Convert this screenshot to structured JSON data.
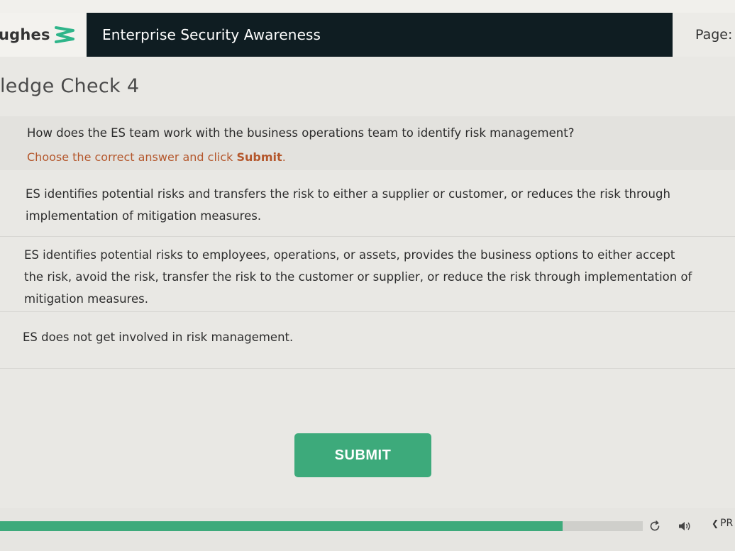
{
  "header": {
    "logo_text": "ughes",
    "course_title": "Enterprise Security Awareness",
    "page_label": "Page:"
  },
  "content": {
    "title": "ledge Check 4",
    "question": "How does the ES team work with the business operations team to identify risk management?",
    "instruction_prefix": "Choose the correct answer and click ",
    "instruction_bold": "Submit",
    "instruction_suffix": ".",
    "options": [
      {
        "text": "ES identifies potential risks and transfers the risk to either a supplier or customer, or reduces the risk through implementation of mitigation measures."
      },
      {
        "line1": "ES identifies potential risks to employees, operations, or assets, provides the business options to either accept",
        "line2": "the risk, avoid the risk, transfer the risk to the customer or supplier, or reduce the risk through implementation of",
        "line3": "mitigation measures."
      },
      {
        "text": "ES does not get involved in risk management."
      }
    ],
    "submit_label": "SUBMIT"
  },
  "footer": {
    "progress": 0.875,
    "prev_label": "PR"
  },
  "colors": {
    "accent_green": "#3daa7b",
    "title_bar": "#0f1d22",
    "instruction_orange": "#b4572c"
  },
  "icons": [
    "logo-mark-icon",
    "replay-icon",
    "volume-icon",
    "chevron-left-icon"
  ]
}
